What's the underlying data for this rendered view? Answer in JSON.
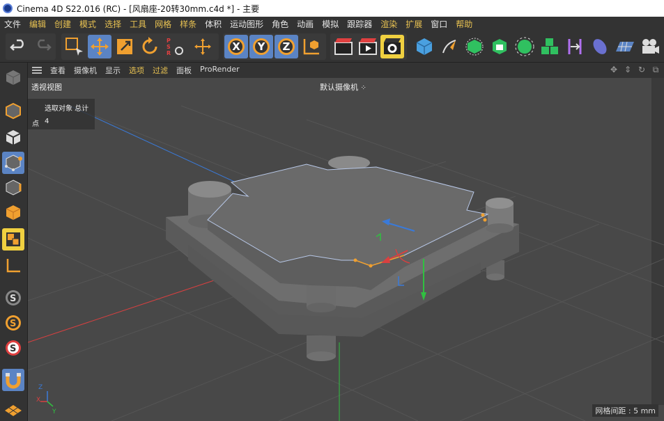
{
  "window": {
    "title": "Cinema 4D S22.016 (RC) - [风扇座-20转30mm.c4d *] - 主要"
  },
  "menubar": {
    "items": [
      {
        "label": "文件",
        "highlight": false
      },
      {
        "label": "编辑",
        "highlight": true
      },
      {
        "label": "创建",
        "highlight": true
      },
      {
        "label": "模式",
        "highlight": true
      },
      {
        "label": "选择",
        "highlight": true
      },
      {
        "label": "工具",
        "highlight": true
      },
      {
        "label": "网格",
        "highlight": true
      },
      {
        "label": "样条",
        "highlight": true
      },
      {
        "label": "体积",
        "highlight": false
      },
      {
        "label": "运动图形",
        "highlight": false
      },
      {
        "label": "角色",
        "highlight": false
      },
      {
        "label": "动画",
        "highlight": false
      },
      {
        "label": "模拟",
        "highlight": false
      },
      {
        "label": "跟踪器",
        "highlight": false
      },
      {
        "label": "渲染",
        "highlight": true
      },
      {
        "label": "扩展",
        "highlight": true
      },
      {
        "label": "窗口",
        "highlight": false
      },
      {
        "label": "帮助",
        "highlight": true
      }
    ]
  },
  "toolbar": {
    "axis_x": "X",
    "axis_y": "Y",
    "axis_z": "Z",
    "psr_letters": "PSR"
  },
  "viewport_menu": {
    "items": [
      {
        "label": "查看",
        "highlight": false
      },
      {
        "label": "摄像机",
        "highlight": false
      },
      {
        "label": "显示",
        "highlight": false
      },
      {
        "label": "选项",
        "highlight": true
      },
      {
        "label": "过滤",
        "highlight": true
      },
      {
        "label": "面板",
        "highlight": false
      },
      {
        "label": "ProRender",
        "highlight": false
      }
    ]
  },
  "viewport": {
    "view_name": "透视视图",
    "camera": "默认摄像机",
    "info": {
      "header": "选取对象 总计",
      "points_label": "点",
      "points_value": "4"
    },
    "grid_spacing": "网格间距 : 5 mm",
    "axis_labels": {
      "x": "X",
      "y": "Y",
      "z": "Z"
    }
  },
  "colors": {
    "accent": "#5b84c4",
    "menu_highlight": "#e8c252",
    "viewport_bg": "#484848",
    "axis_x": "#d94040",
    "axis_y": "#30c040",
    "axis_z": "#3a7ad9"
  }
}
